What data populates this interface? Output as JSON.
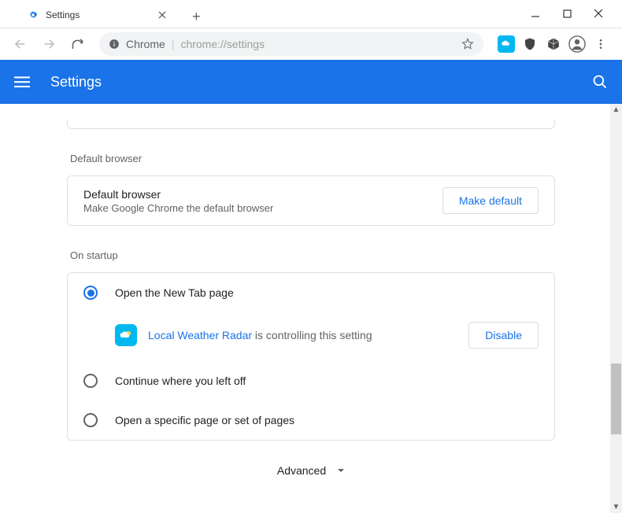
{
  "window": {
    "tab_title": "Settings"
  },
  "omnibox": {
    "scheme_label": "Chrome",
    "url": "chrome://settings"
  },
  "header": {
    "title": "Settings"
  },
  "sections": {
    "default_browser": {
      "title": "Default browser",
      "row_label": "Default browser",
      "row_sub": "Make Google Chrome the default browser",
      "button": "Make default"
    },
    "on_startup": {
      "title": "On startup",
      "options": [
        {
          "label": "Open the New Tab page",
          "checked": true
        },
        {
          "label": "Continue where you left off",
          "checked": false
        },
        {
          "label": "Open a specific page or set of pages",
          "checked": false
        }
      ],
      "extension_notice": {
        "name": "Local Weather Radar",
        "suffix": " is controlling this setting",
        "button": "Disable"
      }
    }
  },
  "advanced_label": "Advanced"
}
